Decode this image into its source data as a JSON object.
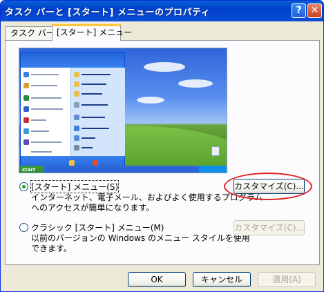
{
  "window": {
    "title": "タスク バーと [スタート] メニューのプロパティ",
    "help_label": "?",
    "close_label": "✕"
  },
  "tabs": [
    {
      "label": "タスク バー",
      "selected": false
    },
    {
      "label": "[スタート] メニュー",
      "selected": true
    }
  ],
  "preview": {
    "start_label": "start"
  },
  "options": {
    "start_menu": {
      "label": "[スタート] メニュー(S)",
      "selected": true,
      "description_line1": "インターネット、電子メール、およびよく使用するプログラム",
      "description_line2": "へのアクセスが簡単になります。",
      "customize_label": "カスタマイズ(C)..."
    },
    "classic_menu": {
      "label": "クラシック [スタート] メニュー(M)",
      "selected": false,
      "description_line1": "以前のバージョンの Windows のメニュー スタイルを使用",
      "description_line2": "できます。",
      "customize_label": "カスタマイズ(C)..."
    }
  },
  "footer": {
    "ok_label": "OK",
    "cancel_label": "キャンセル",
    "apply_label": "適用(A)"
  },
  "colors": {
    "titlebar": "#0040c8",
    "highlight": "#e02020"
  }
}
